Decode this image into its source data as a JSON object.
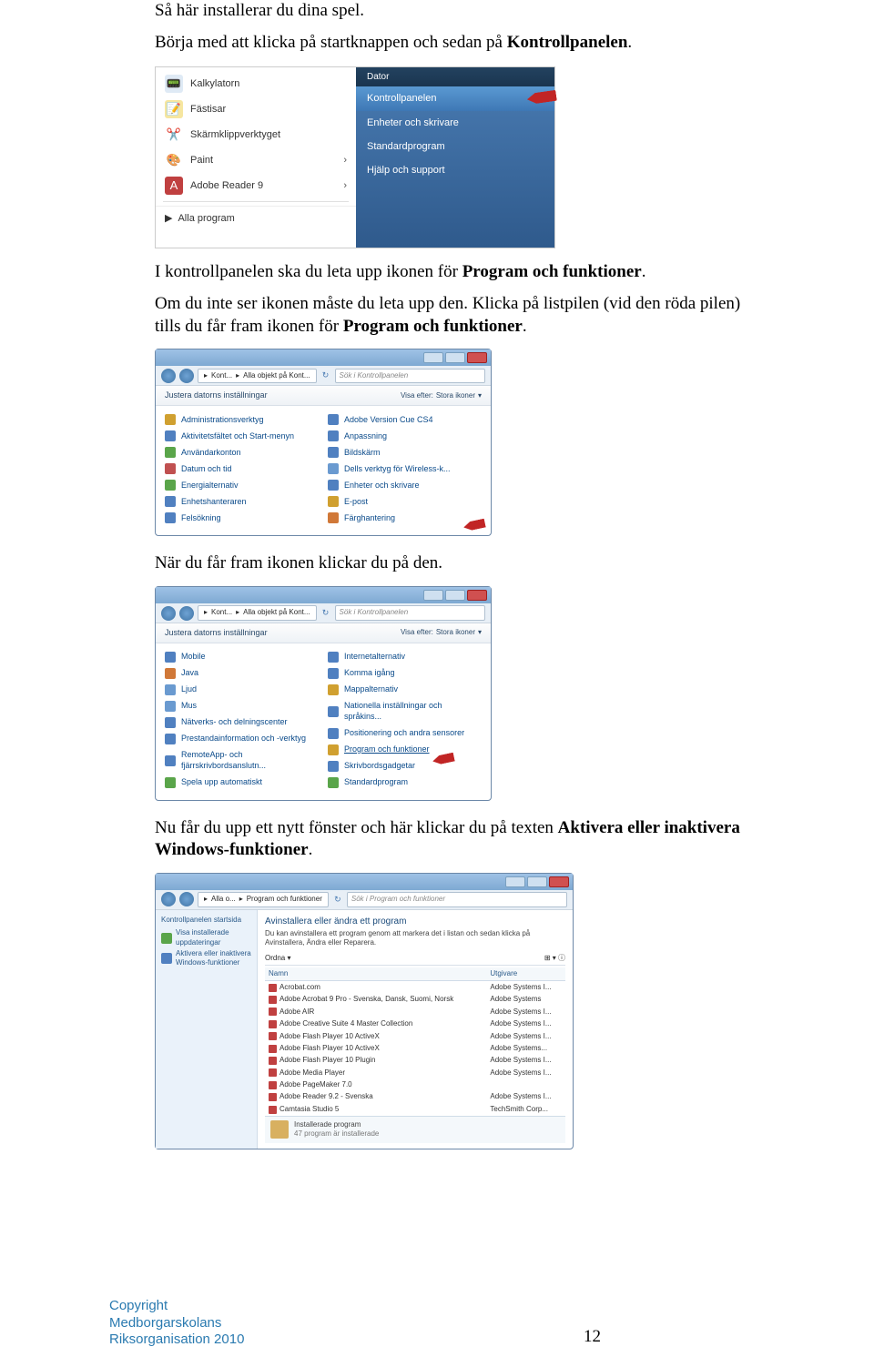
{
  "p1a": "Så här installerar du dina spel.",
  "p1b_pre": "Börja med att klicka på startknappen och sedan på ",
  "p1b_bold": "Kontrollpanelen",
  "p1b_post": ".",
  "startmenu": {
    "left": [
      {
        "label": "Kalkylatorn",
        "icon_bg": "#5080c0"
      },
      {
        "label": "Fästisar",
        "icon_bg": "#d0a030"
      },
      {
        "label": "Skärmklippverktyget",
        "icon_bg": "#d08080"
      },
      {
        "label": "Paint",
        "icon_bg": "#f0f0f0"
      },
      {
        "label": "Adobe Reader 9",
        "icon_bg": "#c04040"
      }
    ],
    "all_programs": "Alla program",
    "right_dark": "Dator",
    "right_items": [
      "Kontrollpanelen",
      "Enheter och skrivare",
      "Standardprogram",
      "Hjälp och support"
    ]
  },
  "p2a_pre": "I kontrollpanelen ska du leta upp ikonen för ",
  "p2a_bold": "Program och funktioner",
  "p2a_post": ".",
  "p2b": "Om du inte ser ikonen måste du leta upp den. Klicka på listpilen (vid den röda pilen) tills du får fram ikonen för ",
  "p2b_bold": "Program och funktioner",
  "p2b_post": ".",
  "cpwin": {
    "crumb1": "Kont...",
    "crumb2": "Alla objekt på Kont...",
    "search": "Sök i Kontrollpanelen",
    "hdr_left": "Justera datorns inställningar",
    "hdr_right_label": "Visa efter:",
    "hdr_right_val": "Stora ikoner",
    "col1": [
      "Administrationsverktyg",
      "Aktivitetsfältet och Start-menyn",
      "Användarkonton",
      "Datum och tid",
      "Energialternativ",
      "Enhetshanteraren",
      "Felsökning"
    ],
    "col2": [
      "Adobe Version Cue CS4",
      "Anpassning",
      "Bildskärm",
      "Dells verktyg för Wireless-k...",
      "Enheter och skrivare",
      "E-post",
      "Färghantering"
    ]
  },
  "p3": "När du får fram ikonen klickar du på den.",
  "cpwin2": {
    "col1": [
      "Mobile",
      "Java",
      "Ljud",
      "Mus",
      "Nätverks- och delningscenter",
      "Prestandainformation och -verktyg",
      "RemoteApp- och fjärrskrivbordsanslutn...",
      "Spela upp automatiskt"
    ],
    "col2": [
      "Internetalternativ",
      "Komma igång",
      "Mappalternativ",
      "Nationella inställningar och språkins...",
      "Positionering och andra sensorer",
      "Program och funktioner",
      "Skrivbordsgadgetar",
      "Standardprogram"
    ]
  },
  "p4_pre": "Nu får du upp ett nytt fönster och här klickar du på texten ",
  "p4_bold": "Aktivera eller inaktivera Windows-funktioner",
  "p4_post": ".",
  "progwin": {
    "crumb1": "Alla o...",
    "crumb2": "Program och funktioner",
    "search": "Sök i Program och funktioner",
    "side_title": "Kontrollpanelen startsida",
    "side_link1": "Visa installerade uppdateringar",
    "side_link2": "Aktivera eller inaktivera Windows-funktioner",
    "main_title": "Avinstallera eller ändra ett program",
    "main_sub": "Du kan avinstallera ett program genom att markera det i listan och sedan klicka på Avinstallera, Ändra eller Reparera.",
    "ordna": "Ordna",
    "th1": "Namn",
    "th2": "Utgivare",
    "rows": [
      {
        "name": "Acrobat.com",
        "pub": "Adobe Systems I..."
      },
      {
        "name": "Adobe Acrobat 9 Pro - Svenska, Dansk, Suomi, Norsk",
        "pub": "Adobe Systems"
      },
      {
        "name": "Adobe AIR",
        "pub": "Adobe Systems I..."
      },
      {
        "name": "Adobe Creative Suite 4 Master Collection",
        "pub": "Adobe Systems I..."
      },
      {
        "name": "Adobe Flash Player 10 ActiveX",
        "pub": "Adobe Systems I..."
      },
      {
        "name": "Adobe Flash Player 10 ActiveX",
        "pub": "Adobe Systems..."
      },
      {
        "name": "Adobe Flash Player 10 Plugin",
        "pub": "Adobe Systems I..."
      },
      {
        "name": "Adobe Media Player",
        "pub": "Adobe Systems I..."
      },
      {
        "name": "Adobe PageMaker 7.0",
        "pub": ""
      },
      {
        "name": "Adobe Reader 9.2 - Svenska",
        "pub": "Adobe Systems I..."
      },
      {
        "name": "Camtasia Studio 5",
        "pub": "TechSmith Corp..."
      }
    ],
    "foot_title": "Installerade program",
    "foot_sub": "47 program är installerade"
  },
  "footer": {
    "l1": "Copyright",
    "l2": "Medborgarskolans",
    "l3": "Riksorganisation 2010",
    "page": "12"
  }
}
